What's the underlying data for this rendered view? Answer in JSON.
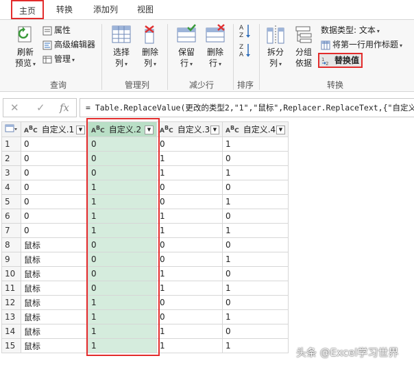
{
  "tabs": [
    {
      "label": "主页"
    },
    {
      "label": "转换"
    },
    {
      "label": "添加列"
    },
    {
      "label": "视图"
    }
  ],
  "ribbon": {
    "query": {
      "refresh_label": "刷新",
      "preview_label": "预览",
      "properties_label": "属性",
      "advanced_editor_label": "高级编辑器",
      "manage_label": "管理",
      "group_label": "查询"
    },
    "manage_columns": {
      "choose_label": "选择",
      "choose_sub": "列",
      "remove_label": "删除",
      "remove_sub": "列",
      "group_label": "管理列"
    },
    "reduce_rows": {
      "keep_label": "保留",
      "keep_sub": "行",
      "remove_label": "删除",
      "remove_sub": "行",
      "group_label": "减少行"
    },
    "sort": {
      "group_label": "排序"
    },
    "transform": {
      "split_label": "拆分",
      "split_sub": "列",
      "groupby_label": "分组",
      "groupby_sub": "依据",
      "datatype_label": "数据类型: 文本",
      "first_row_header_label": "将第一行用作标题",
      "replace_values_label": "替换值",
      "group_label": "转换"
    }
  },
  "formula_bar": {
    "fx_label": "fx",
    "formula": "= Table.ReplaceValue(更改的类型2,\"1\",\"鼠标\",Replacer.ReplaceText,{\"自定义.1\"})"
  },
  "table": {
    "columns": [
      "自定义.1",
      "自定义.2",
      "自定义.3",
      "自定义.4"
    ],
    "rows": [
      [
        "1",
        "0",
        "0",
        "0",
        "1"
      ],
      [
        "2",
        "0",
        "0",
        "1",
        "0"
      ],
      [
        "3",
        "0",
        "0",
        "1",
        "1"
      ],
      [
        "4",
        "0",
        "1",
        "0",
        "0"
      ],
      [
        "5",
        "0",
        "1",
        "0",
        "1"
      ],
      [
        "6",
        "0",
        "1",
        "1",
        "0"
      ],
      [
        "7",
        "0",
        "1",
        "1",
        "1"
      ],
      [
        "8",
        "鼠标",
        "0",
        "0",
        "0"
      ],
      [
        "9",
        "鼠标",
        "0",
        "0",
        "1"
      ],
      [
        "10",
        "鼠标",
        "0",
        "1",
        "0"
      ],
      [
        "11",
        "鼠标",
        "0",
        "1",
        "1"
      ],
      [
        "12",
        "鼠标",
        "1",
        "0",
        "0"
      ],
      [
        "13",
        "鼠标",
        "1",
        "0",
        "1"
      ],
      [
        "14",
        "鼠标",
        "1",
        "1",
        "0"
      ],
      [
        "15",
        "鼠标",
        "1",
        "1",
        "1"
      ]
    ]
  },
  "watermark": "头条 @Excel学习世界",
  "colors": {
    "highlight_border": "#e32b2b",
    "selected_column": "#d5ecdd"
  }
}
